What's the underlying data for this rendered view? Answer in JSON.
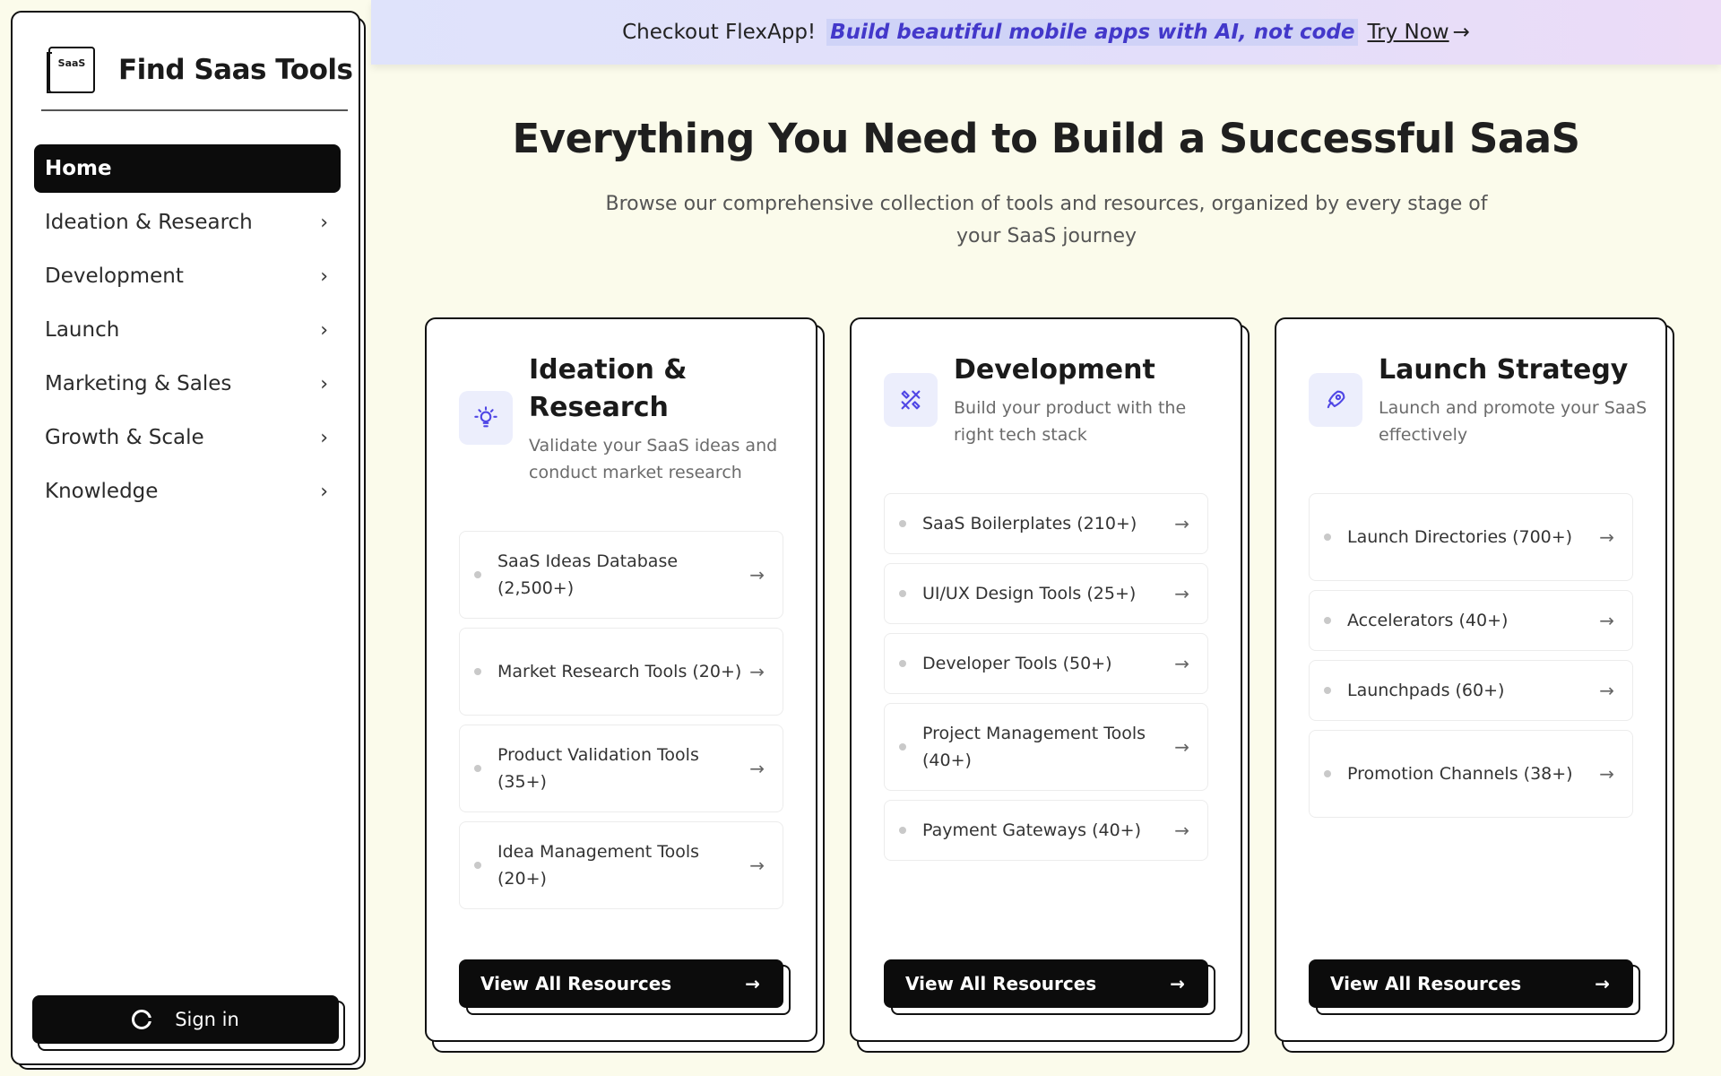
{
  "sidebar": {
    "logo_text": "SaaS",
    "brand": "Find Saas Tools",
    "items": [
      {
        "label": "Home"
      },
      {
        "label": "Ideation & Research"
      },
      {
        "label": "Development"
      },
      {
        "label": "Launch"
      },
      {
        "label": "Marketing & Sales"
      },
      {
        "label": "Growth & Scale"
      },
      {
        "label": "Knowledge"
      }
    ],
    "signin_label": "Sign in"
  },
  "banner": {
    "promo": "Checkout FlexApp!",
    "tagline": "Build beautiful mobile apps with AI, not code",
    "cta": "Try Now",
    "arrow": "→"
  },
  "main": {
    "headline": "Everything You Need to Build a Successful SaaS",
    "subline": "Browse our comprehensive collection of tools and resources, organized by every stage of your SaaS journey"
  },
  "cards": [
    {
      "icon": "lightbulb-icon",
      "title": "Ideation & Research",
      "description": "Validate your SaaS ideas and conduct market research",
      "items": [
        {
          "label": "SaaS Ideas Database (2,500+)"
        },
        {
          "label": "Market Research Tools (20+)"
        },
        {
          "label": "Product Validation Tools (35+)"
        },
        {
          "label": "Idea Management Tools (20+)"
        }
      ],
      "button": "View All Resources"
    },
    {
      "icon": "tools-icon",
      "title": "Development",
      "description": "Build your product with the right tech stack",
      "items": [
        {
          "label": "SaaS Boilerplates (210+)"
        },
        {
          "label": "UI/UX Design Tools (25+)"
        },
        {
          "label": "Developer Tools (50+)"
        },
        {
          "label": "Project Management Tools (40+)"
        },
        {
          "label": "Payment Gateways (40+)"
        }
      ],
      "button": "View All Resources"
    },
    {
      "icon": "rocket-icon",
      "title": "Launch Strategy",
      "description": "Launch and promote your SaaS effectively",
      "items": [
        {
          "label": "Launch Directories (700+)"
        },
        {
          "label": "Accelerators (40+)"
        },
        {
          "label": "Launchpads (60+)"
        },
        {
          "label": "Promotion Channels (38+)"
        }
      ],
      "button": "View All Resources"
    }
  ],
  "colors": {
    "background": "#fbfbeb",
    "accent": "#4f46e5",
    "dark": "#0c0c0c"
  }
}
